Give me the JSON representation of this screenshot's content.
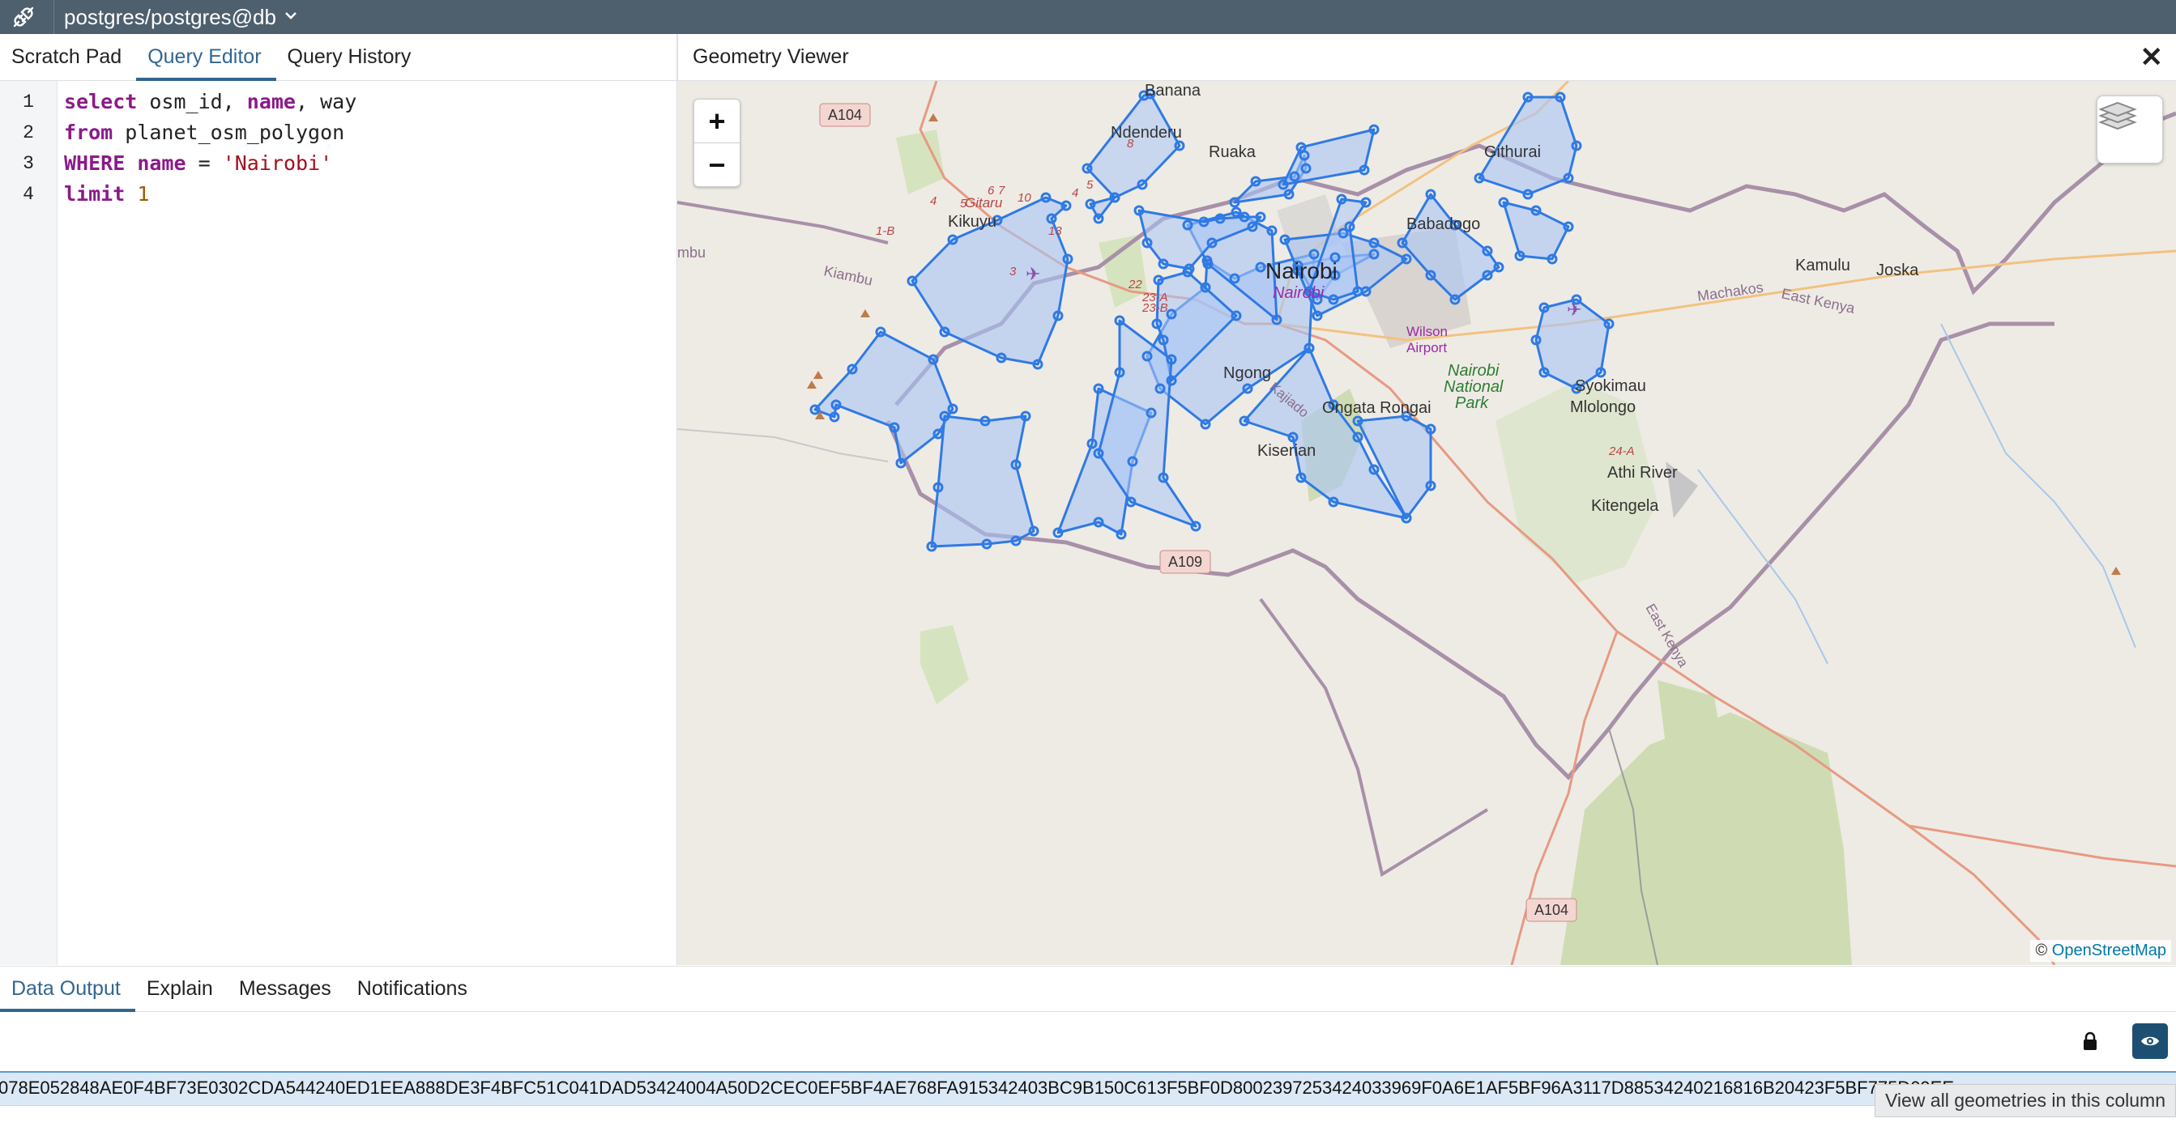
{
  "topbar": {
    "connection": "postgres/postgres@db",
    "icon": "plug-connection-icon"
  },
  "left_tabs": [
    "Scratch Pad",
    "Query Editor",
    "Query History"
  ],
  "active_left_tab": "Query Editor",
  "editor": {
    "line_numbers": [
      "1",
      "2",
      "3",
      "4"
    ],
    "lines": [
      {
        "t1": "select",
        "t2": " osm_id, ",
        "t3": "name",
        "t4": ", way"
      },
      {
        "t1": "from",
        "t2": " planet_osm_polygon"
      },
      {
        "t1": "WHERE",
        "t2": " ",
        "t3": "name",
        "t4": " = ",
        "t5": "'Nairobi'"
      },
      {
        "t1": "limit",
        "t2": " ",
        "t3": "1"
      }
    ]
  },
  "viewer": {
    "title": "Geometry Viewer",
    "close_label": "✕",
    "zoom_in": "+",
    "zoom_out": "−",
    "attribution_prefix": "©",
    "attribution_link": "OpenStreetMap",
    "place_labels": {
      "banana": "Banana",
      "ndenderu": "Ndenderu",
      "ruaka": "Ruaka",
      "githurai": "Githurai",
      "gitaru": "Gitaru",
      "kikuyu": "Kikuyu",
      "babadogo": "Babadogo",
      "nairobi": "Nairobi",
      "nairobi_purple": "Nairobi",
      "kiambu": "Kiambu",
      "mbu": "mbu",
      "kamulu": "Kamulu",
      "joska": "Joska",
      "machakos": "Machakos",
      "east_kenya": "East Kenya",
      "wilson": "Wilson",
      "airport": "Airport",
      "ngong": "Ngong",
      "kajiado": "Kajiado",
      "nairobi_np1": "Nairobi",
      "nairobi_np2": "National",
      "nairobi_np3": "Park",
      "syokimau": "Syokimau",
      "mlolongo": "Mlolongo",
      "ongata_rongai": "Ongata Rongai",
      "kiserian": "Kiserian",
      "athi_river": "Athi River",
      "kitengela": "Kitengela",
      "east_kenya2": "East Kenya"
    },
    "road_shields": {
      "a104_top": "A104",
      "a104_bottom": "A104",
      "a109": "A109"
    },
    "road_numbers": {
      "r1b": "1-B",
      "r13": "13",
      "r22": "22",
      "r23a": "23-A",
      "r23b": "23-B",
      "r24a": "24-A",
      "r4": "4",
      "r5": "5",
      "r6": "6",
      "r7": "7",
      "r10": "10",
      "r3": "3",
      "r8": "8",
      "r4b": "4",
      "r5b": "5"
    }
  },
  "bottom_tabs": [
    "Data Output",
    "Explain",
    "Messages",
    "Notifications"
  ],
  "active_bottom_tab": "Data Output",
  "data_output": {
    "cell_value": "078E052848AE0F4BF73E0302CDA544240ED1EEA888DE3F4BFC51C041DAD53424004A50D2CEC0EF5BF4AE768FA915342403BC9B150C613F5BF0D8002397253424033969F0A6E1AF5BF96A3117D88534240216816B20423F5BF775D09EE",
    "tooltip": "View all geometries in this column"
  },
  "colors": {
    "accent": "#326690",
    "polygon_stroke": "#3b82f6",
    "polygon_fill": "#a9c4f5",
    "topbar": "#4e5f6e"
  }
}
